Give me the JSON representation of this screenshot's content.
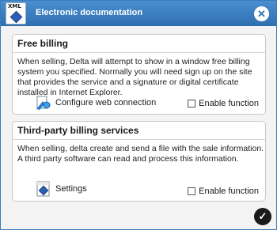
{
  "window": {
    "title": "Electronic documentation",
    "icon_label": "XML",
    "close_icon": "close-icon",
    "confirm_icon": "checkmark-icon"
  },
  "panels": [
    {
      "heading": "Free billing",
      "description": "When selling, Delta will attempt to show in a window free billing system you specified. Normally you will need sign up on the site that provides the service and a signature or digital certificate installed in Internet Explorer.",
      "action_label": "Configure web connection",
      "action_icon": "web-connection-icon",
      "checkbox_label": "Enable function",
      "checkbox_checked": false
    },
    {
      "heading": "Third-party billing services",
      "description": "When selling, delta create and send a file with the sale information. A third party software can read and process this information.",
      "action_label": "Settings",
      "action_icon": "settings-icon",
      "checkbox_label": "Enable function",
      "checkbox_checked": false
    }
  ],
  "colors": {
    "titlebar": "#2e6fb0",
    "accent": "#4a8fd0"
  }
}
